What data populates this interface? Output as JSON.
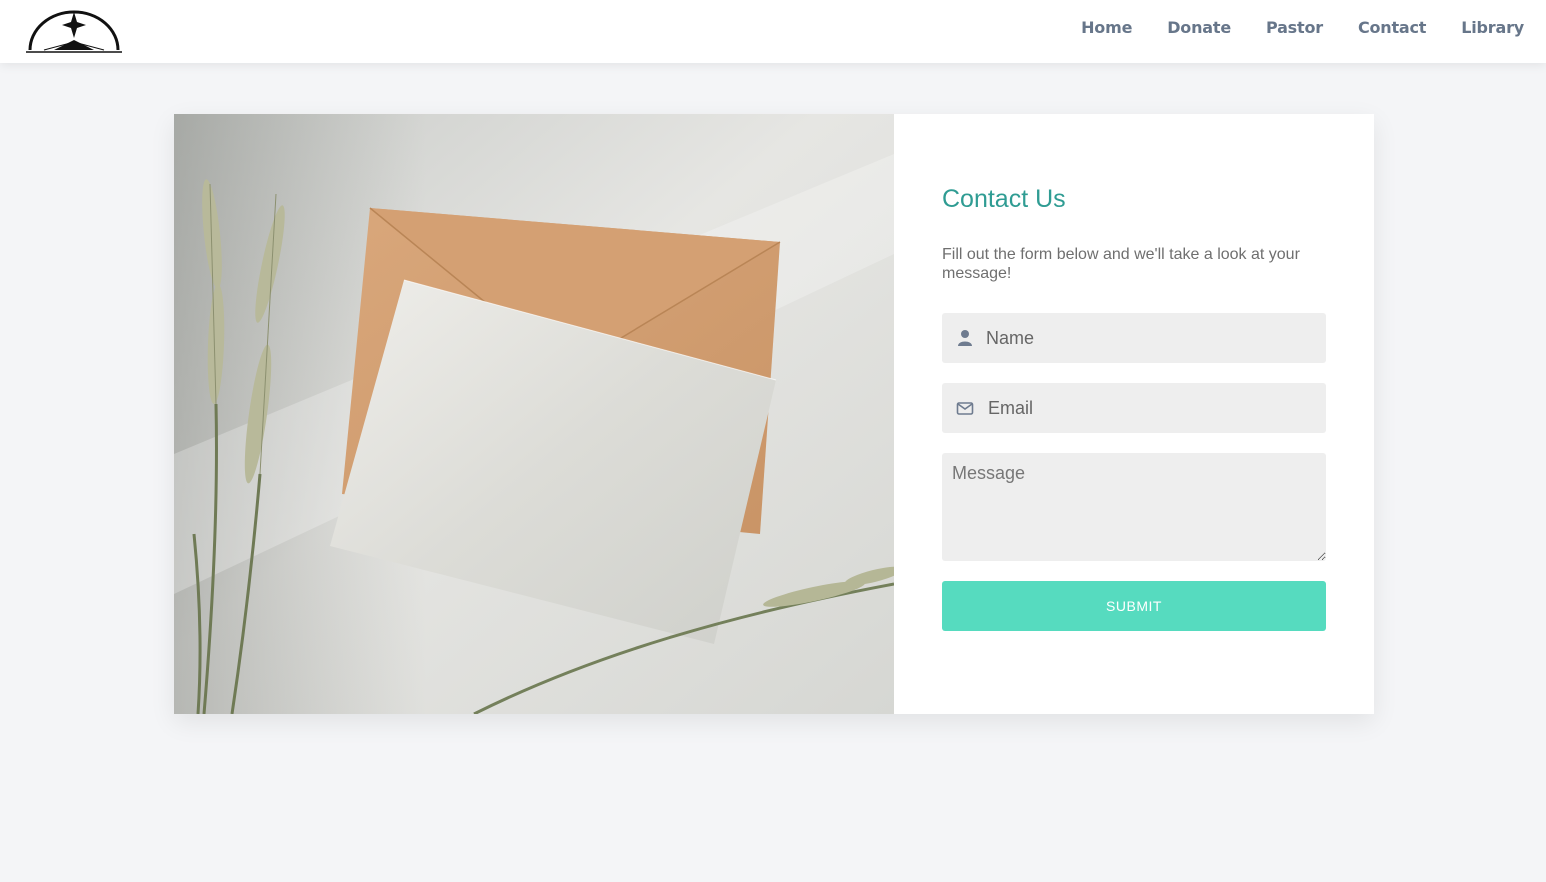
{
  "header": {
    "logo_icon": "church-dome-star-logo-icon",
    "nav": [
      {
        "label": "Home"
      },
      {
        "label": "Donate"
      },
      {
        "label": "Pastor"
      },
      {
        "label": "Contact"
      },
      {
        "label": "Library"
      }
    ]
  },
  "contact": {
    "title": "Contact Us",
    "subtitle": "Fill out the form below and we'll take a look at your message!",
    "name_placeholder": "Name",
    "email_placeholder": "Email",
    "message_placeholder": "Message",
    "submit_label": "SUBMIT",
    "name_icon": "user-icon",
    "email_icon": "envelope-icon"
  },
  "colors": {
    "accent": "#2f9c93",
    "button": "#56dbbf",
    "nav_text": "#67768a",
    "background": "#f4f5f7",
    "field_bg": "#eeeeee"
  }
}
